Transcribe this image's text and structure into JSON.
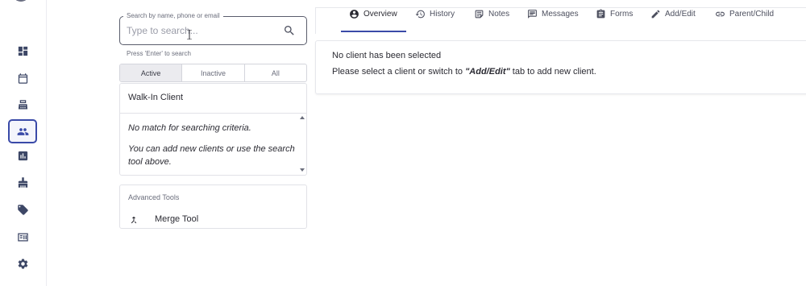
{
  "rail": {
    "items": [
      {
        "icon": "dashboard-icon"
      },
      {
        "icon": "calendar-icon"
      },
      {
        "icon": "register-icon"
      },
      {
        "icon": "clients-icon",
        "active": true
      },
      {
        "icon": "reports-icon"
      },
      {
        "icon": "grooming-icon"
      },
      {
        "icon": "tag-icon"
      },
      {
        "icon": "id-card-icon"
      },
      {
        "icon": "gear-icon"
      }
    ]
  },
  "search": {
    "legend": "Search by name, phone or email",
    "placeholder": "Type to search...",
    "value": "",
    "hint": "Press 'Enter' to search"
  },
  "filter_tabs": [
    {
      "label": "Active",
      "selected": true
    },
    {
      "label": "Inactive",
      "selected": false
    },
    {
      "label": "All",
      "selected": false
    }
  ],
  "client_list": {
    "walk_in": "Walk-In Client",
    "no_match": "No match for searching criteria.",
    "add_hint": "You can add new clients or use the search tool above."
  },
  "advanced_tools": {
    "title": "Advanced Tools",
    "merge_label": "Merge Tool"
  },
  "tabs": [
    {
      "label": "Overview",
      "icon": "account-circle-icon",
      "active": true
    },
    {
      "label": "History",
      "icon": "history-icon"
    },
    {
      "label": "Notes",
      "icon": "notes-icon"
    },
    {
      "label": "Messages",
      "icon": "messages-icon"
    },
    {
      "label": "Forms",
      "icon": "clipboard-icon"
    },
    {
      "label": "Add/Edit",
      "icon": "pencil-icon"
    },
    {
      "label": "Parent/Child",
      "icon": "link-icon"
    }
  ],
  "content": {
    "line1": "No client has been selected",
    "line2_prefix": "Please select a client or switch to ",
    "line2_em": "\"Add/Edit\"",
    "line2_suffix": " tab to add new client."
  },
  "colors": {
    "accent": "#3a4aa8",
    "text": "#2b2b33",
    "muted": "#6b6e7c"
  }
}
